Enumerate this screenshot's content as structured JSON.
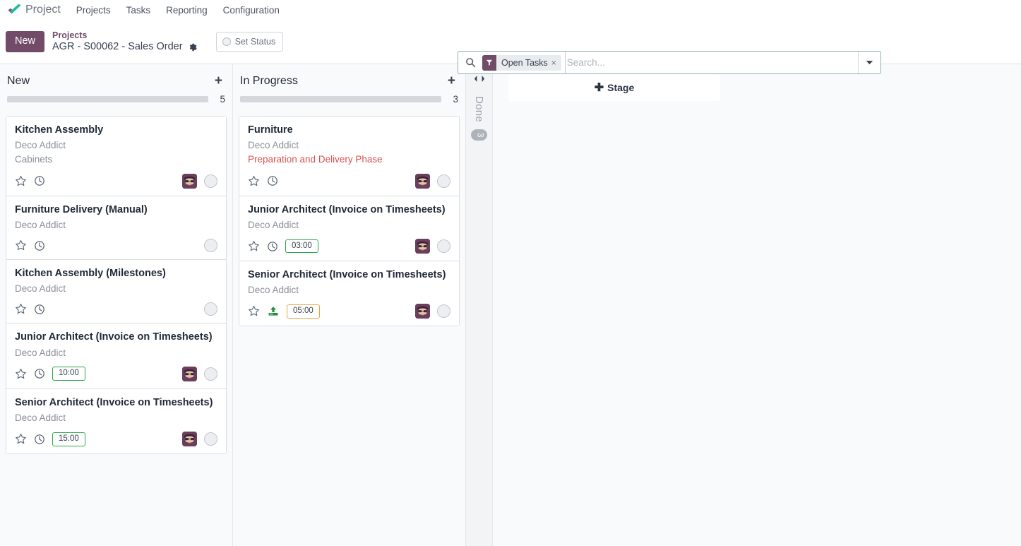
{
  "navbar": {
    "logo_icon": "odoo-check-logo",
    "app_name": "Project",
    "menu": [
      {
        "label": "Projects"
      },
      {
        "label": "Tasks"
      },
      {
        "label": "Reporting"
      },
      {
        "label": "Configuration"
      }
    ]
  },
  "control_panel": {
    "new_label": "New",
    "breadcrumb_parent": "Projects",
    "breadcrumb_current": "AGR - S00062 - Sales Order",
    "gear_icon": "gear-icon",
    "set_status_label": "Set Status"
  },
  "search": {
    "search_icon": "search-icon",
    "facet_icon": "filter-icon",
    "facet_label": "Open Tasks",
    "facet_close": "×",
    "placeholder": "Search...",
    "value": "",
    "dropdown_icon": "chevron-down-icon"
  },
  "kanban": {
    "add_stage_label": "Stage",
    "add_stage_plus": "➕",
    "columns": [
      {
        "title": "New",
        "count": "5",
        "add_icon": "plus-icon",
        "cards": [
          {
            "title": "Kitchen Assembly",
            "customer": "Deco Addict",
            "tag": "Cabinets",
            "tag_color": "#8a8f98",
            "star_icon": "star-icon",
            "second_icon": "clock-icon",
            "time": null,
            "time_state": null,
            "avatar": true,
            "state_icon": "kanban-state-circle"
          },
          {
            "title": "Furniture Delivery (Manual)",
            "customer": "Deco Addict",
            "tag": null,
            "tag_color": null,
            "star_icon": "star-icon",
            "second_icon": "clock-icon",
            "time": null,
            "time_state": null,
            "avatar": false,
            "state_icon": "kanban-state-circle"
          },
          {
            "title": "Kitchen Assembly (Milestones)",
            "customer": "Deco Addict",
            "tag": null,
            "tag_color": null,
            "star_icon": "star-icon",
            "second_icon": "clock-icon",
            "time": null,
            "time_state": null,
            "avatar": false,
            "state_icon": "kanban-state-circle"
          },
          {
            "title": "Junior Architect (Invoice on Timesheets)",
            "customer": "Deco Addict",
            "tag": null,
            "tag_color": null,
            "star_icon": "star-icon",
            "second_icon": "clock-icon",
            "time": "10:00",
            "time_state": "ok",
            "avatar": true,
            "state_icon": "kanban-state-circle"
          },
          {
            "title": "Senior Architect (Invoice on Timesheets)",
            "customer": "Deco Addict",
            "tag": null,
            "tag_color": null,
            "star_icon": "star-icon",
            "second_icon": "clock-icon",
            "time": "15:00",
            "time_state": "ok",
            "avatar": true,
            "state_icon": "kanban-state-circle"
          }
        ]
      },
      {
        "title": "In Progress",
        "count": "3",
        "add_icon": "plus-icon",
        "cards": [
          {
            "title": "Furniture",
            "customer": "Deco Addict",
            "tag": "Preparation and Delivery Phase",
            "tag_color": "#d9534f",
            "star_icon": "star-icon",
            "second_icon": "clock-icon",
            "time": null,
            "time_state": null,
            "avatar": true,
            "state_icon": "kanban-state-circle"
          },
          {
            "title": "Junior Architect (Invoice on Timesheets)",
            "customer": "Deco Addict",
            "tag": null,
            "tag_color": null,
            "star_icon": "star-icon",
            "second_icon": "clock-icon",
            "time": "03:00",
            "time_state": "ok",
            "avatar": true,
            "state_icon": "kanban-state-circle"
          },
          {
            "title": "Senior Architect (Invoice on Timesheets)",
            "customer": "Deco Addict",
            "tag": null,
            "tag_color": null,
            "star_icon": "star-icon",
            "second_icon": "upload-icon",
            "time": "05:00",
            "time_state": "warn",
            "avatar": true,
            "state_icon": "kanban-state-circle"
          }
        ]
      }
    ],
    "folded_column": {
      "toggle_icon": "expand-collapse-icon",
      "title": "Done",
      "count": "3"
    }
  },
  "colors": {
    "brand_purple": "#714b67",
    "accent_teal": "#1abc9c",
    "badge_ok_border": "#28a745",
    "badge_warn_border": "#e8a33d",
    "tag_red": "#d9534f",
    "progress_gray": "#d5d7dd"
  }
}
